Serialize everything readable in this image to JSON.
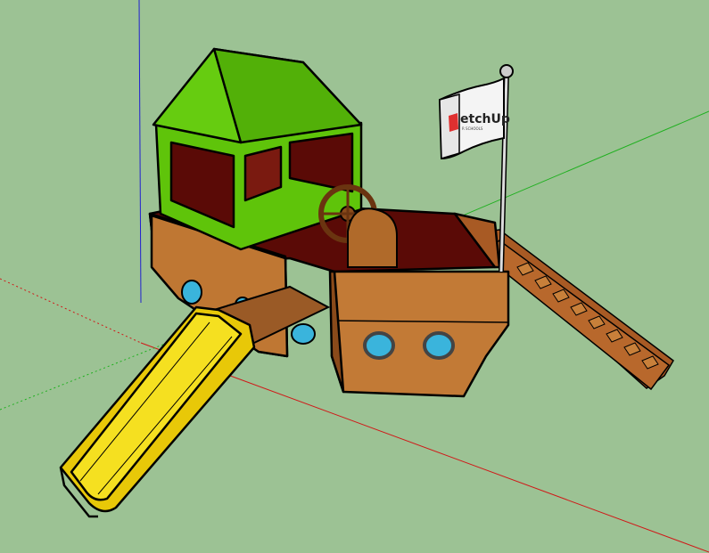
{
  "viewport": {
    "background": "#9cc294",
    "axes": {
      "red": "#d01818",
      "green": "#20b020",
      "blue": "#2020d0"
    }
  },
  "model": {
    "flag": {
      "logo_text": "SketchUp",
      "logo_subtext": "FOR SCHOOLS",
      "logo_color": "#e03030"
    },
    "colors": {
      "roof": "#5fc40a",
      "wood": "#b8702c",
      "floor": "#5a0a06",
      "slide": "#f2d80a",
      "porthole": "#3ab4dc"
    }
  }
}
